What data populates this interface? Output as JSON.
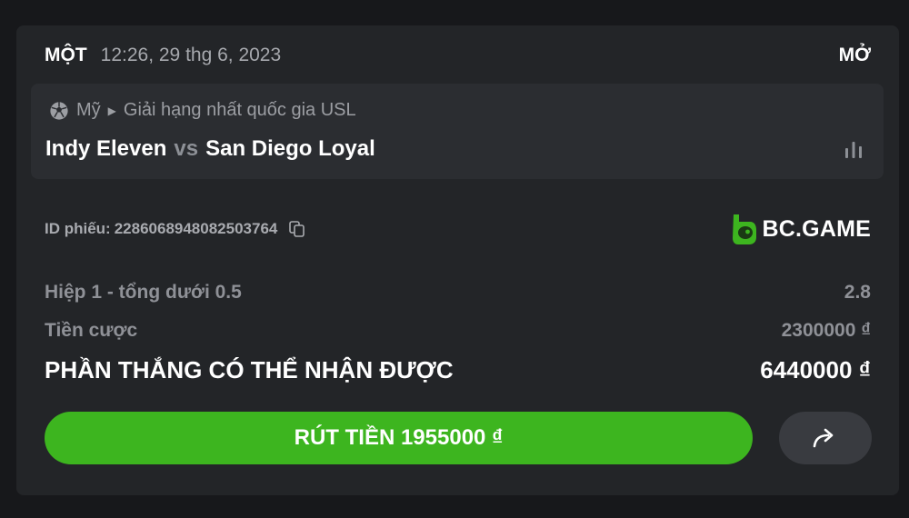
{
  "header": {
    "bet_type": "MỘT",
    "timestamp": "12:26, 29 thg 6, 2023",
    "status": "MỞ"
  },
  "match": {
    "sport_icon": "soccer-ball-icon",
    "country": "Mỹ",
    "league": "Giải hạng nhất quốc gia USL",
    "home_team": "Indy Eleven",
    "vs": "vs",
    "away_team": "San Diego Loyal",
    "stats_icon": "bar-chart-icon"
  },
  "ticket": {
    "id_label": "ID phiếu:",
    "id_value": "2286068948082503764",
    "copy_icon": "copy-icon"
  },
  "brand": {
    "name": "BC.GAME",
    "logo_color": "#3db51f"
  },
  "details": {
    "market_label": "Hiệp 1 - tổng dưới 0.5",
    "odds": "2.8",
    "stake_label": "Tiền cược",
    "stake_value": "2300000 ₫",
    "payout_label": "PHẦN THẮNG CÓ THỂ NHẬN ĐƯỢC",
    "payout_value": "6440000 ₫"
  },
  "actions": {
    "cashout_label": "RÚT TIỀN 1955000 ₫",
    "share_icon": "share-arrow-icon"
  },
  "colors": {
    "background": "#17181b",
    "card": "#232528",
    "match_box": "#2b2d31",
    "accent_green": "#3db51f",
    "share_button": "#393b40"
  }
}
